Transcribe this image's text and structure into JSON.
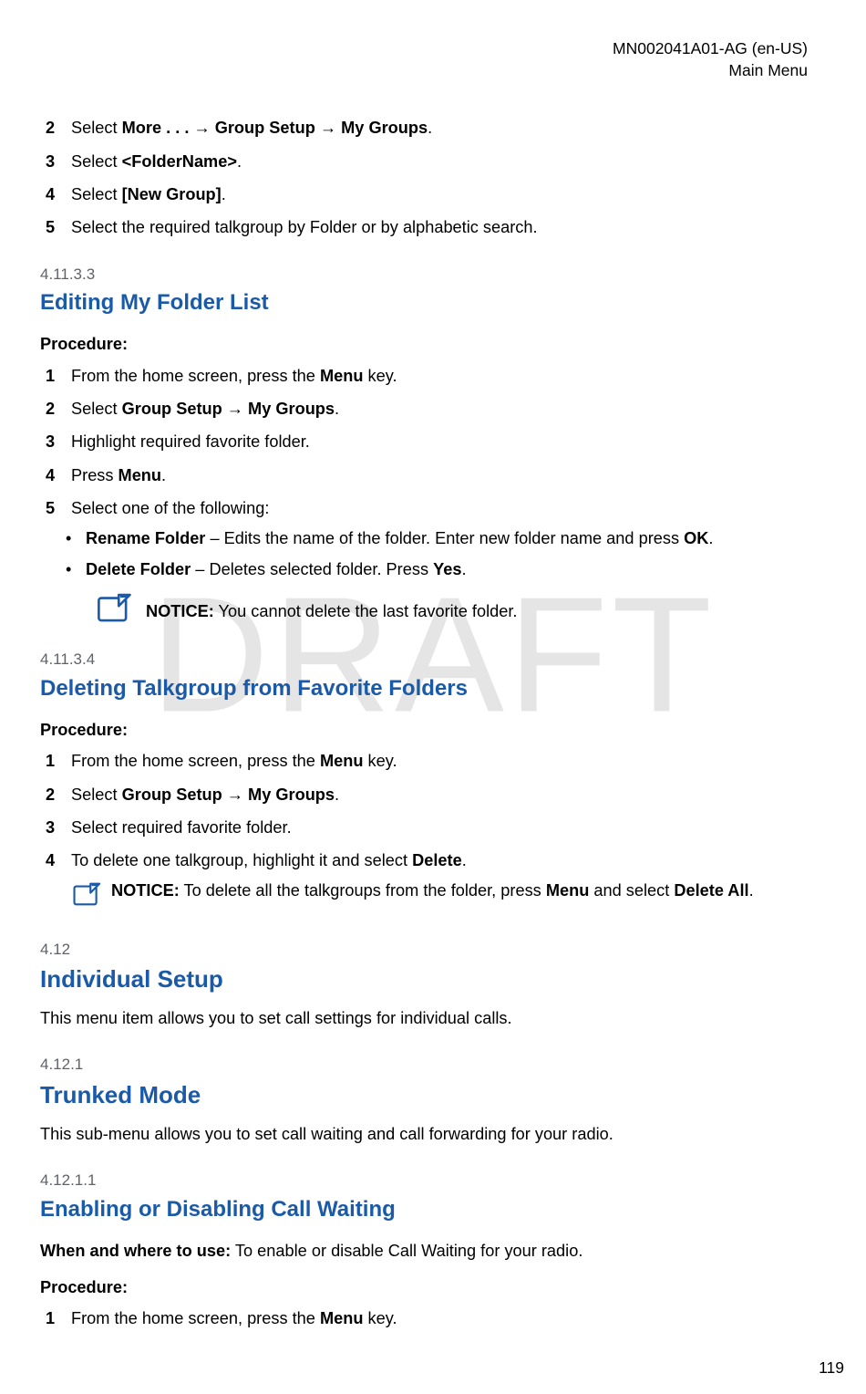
{
  "header": {
    "doc_code": "MN002041A01-AG (en-US)",
    "section_title": "Main Menu"
  },
  "watermark": "DRAFT",
  "page_number": "119",
  "top_steps": {
    "items": [
      {
        "num": "2",
        "parts": [
          "Select ",
          "More . . .",
          " → ",
          "Group Setup",
          " → ",
          "My Groups",
          "."
        ]
      },
      {
        "num": "3",
        "parts": [
          "Select ",
          "<FolderName>",
          "."
        ]
      },
      {
        "num": "4",
        "parts": [
          "Select ",
          "[New Group]",
          "."
        ]
      },
      {
        "num": "5",
        "parts": [
          "Select the required talkgroup by Folder or by alphabetic search."
        ]
      }
    ]
  },
  "sec_41133": {
    "number": "4.11.3.3",
    "title": "Editing My Folder List",
    "procedure_label": "Procedure:",
    "steps": [
      {
        "num": "1",
        "parts": [
          "From the home screen, press the ",
          "Menu",
          " key."
        ]
      },
      {
        "num": "2",
        "parts": [
          "Select ",
          "Group Setup",
          " → ",
          "My Groups",
          "."
        ]
      },
      {
        "num": "3",
        "parts": [
          "Highlight required favorite folder."
        ]
      },
      {
        "num": "4",
        "parts": [
          "Press ",
          "Menu",
          "."
        ]
      },
      {
        "num": "5",
        "parts": [
          "Select one of the following:"
        ]
      }
    ],
    "bullets": [
      {
        "parts": [
          "Rename Folder",
          " – Edits the name of the folder. Enter new folder name and press ",
          "OK",
          "."
        ]
      },
      {
        "parts": [
          "Delete Folder",
          " – Deletes selected folder. Press ",
          "Yes",
          "."
        ]
      }
    ],
    "notice": {
      "label": "NOTICE:",
      "text": " You cannot delete the last favorite folder."
    }
  },
  "sec_41134": {
    "number": "4.11.3.4",
    "title": "Deleting Talkgroup from Favorite Folders",
    "procedure_label": "Procedure:",
    "steps": [
      {
        "num": "1",
        "parts": [
          "From the home screen, press the ",
          "Menu",
          " key."
        ]
      },
      {
        "num": "2",
        "parts": [
          "Select ",
          "Group Setup",
          " → ",
          "My Groups",
          "."
        ]
      },
      {
        "num": "3",
        "parts": [
          "Select required favorite folder."
        ]
      },
      {
        "num": "4",
        "parts": [
          "To delete one talkgroup, highlight it and select ",
          "Delete",
          "."
        ]
      }
    ],
    "notice": {
      "label": "NOTICE:",
      "text_parts": [
        " To delete all the talkgroups from the folder, press ",
        "Menu",
        " and select ",
        "Delete All",
        "."
      ]
    }
  },
  "sec_412": {
    "number": "4.12",
    "title": "Individual Setup",
    "desc": "This menu item allows you to set call settings for individual calls."
  },
  "sec_4121": {
    "number": "4.12.1",
    "title": "Trunked Mode",
    "desc": "This sub-menu allows you to set call waiting and call forwarding for your radio."
  },
  "sec_41211": {
    "number": "4.12.1.1",
    "title": "Enabling or Disabling Call Waiting",
    "when_label": "When and where to use:",
    "when_text": " To enable or disable Call Waiting for your radio.",
    "procedure_label": "Procedure:",
    "steps": [
      {
        "num": "1",
        "parts": [
          "From the home screen, press the ",
          "Menu",
          " key."
        ]
      }
    ]
  }
}
